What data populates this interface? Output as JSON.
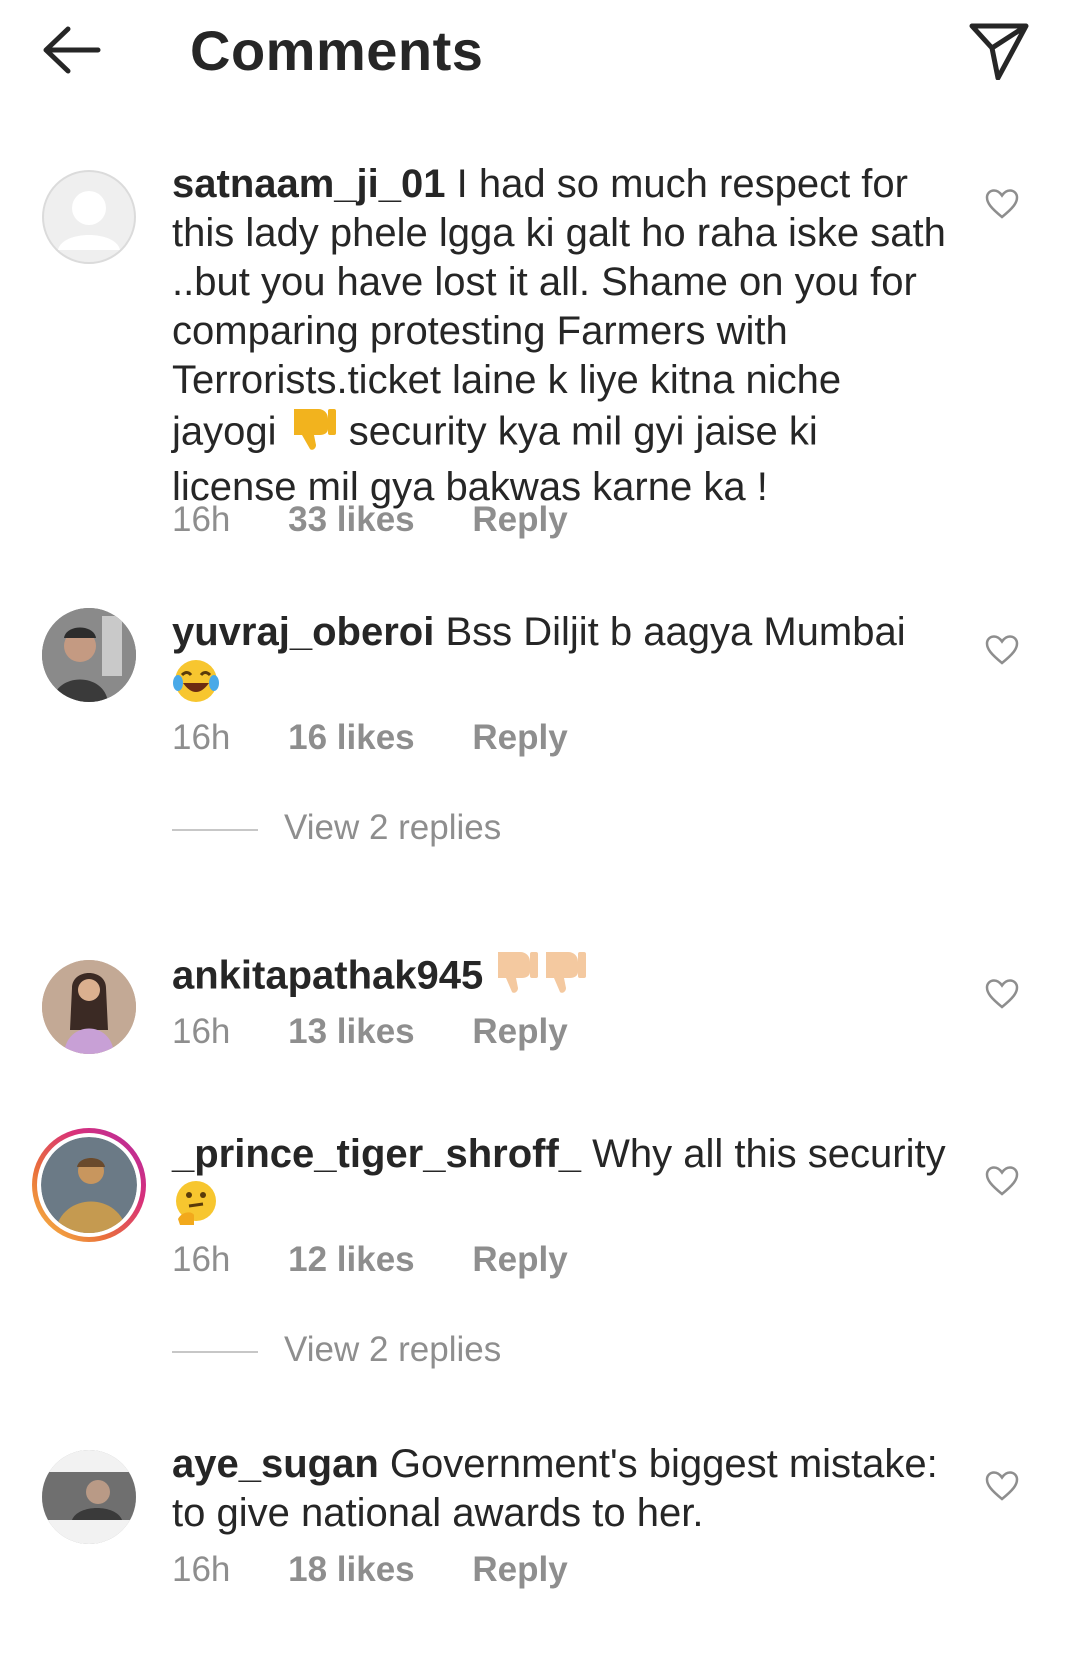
{
  "header": {
    "title": "Comments",
    "back_icon": "arrow-left-icon",
    "send_icon": "paper-plane-icon"
  },
  "comments": [
    {
      "username": "satnaam_ji_01",
      "text": "I had so much respect for this lady phele lgga ki galt ho raha iske sath ..but you have lost it all. Shame on you for comparing protesting Farmers with Terrorists.ticket laine k liye kitna niche jayogi",
      "text_after_emoji": "security kya mil gyi jaise ki license mil gya bakwas karne ka !",
      "emoji": "thumbs-down",
      "time": "16h",
      "likes": "33 likes",
      "reply": "Reply"
    },
    {
      "username": "yuvraj_oberoi",
      "text": "Bss Diljit b aagya Mumbai",
      "emoji": "laughing-tears",
      "time": "16h",
      "likes": "16 likes",
      "reply": "Reply",
      "view_replies": "View 2 replies"
    },
    {
      "username": "ankitapathak945",
      "text": "",
      "emoji": "thumbs-down-x2",
      "time": "16h",
      "likes": "13 likes",
      "reply": "Reply"
    },
    {
      "username": "_prince_tiger_shroff_",
      "text": "Why all this security",
      "emoji": "thinking-face",
      "time": "16h",
      "likes": "12 likes",
      "reply": "Reply",
      "view_replies": "View 2 replies"
    },
    {
      "username": "aye_sugan",
      "text": "Government's biggest mistake: to give national awards to her.",
      "time": "16h",
      "likes": "18 likes",
      "reply": "Reply"
    }
  ]
}
